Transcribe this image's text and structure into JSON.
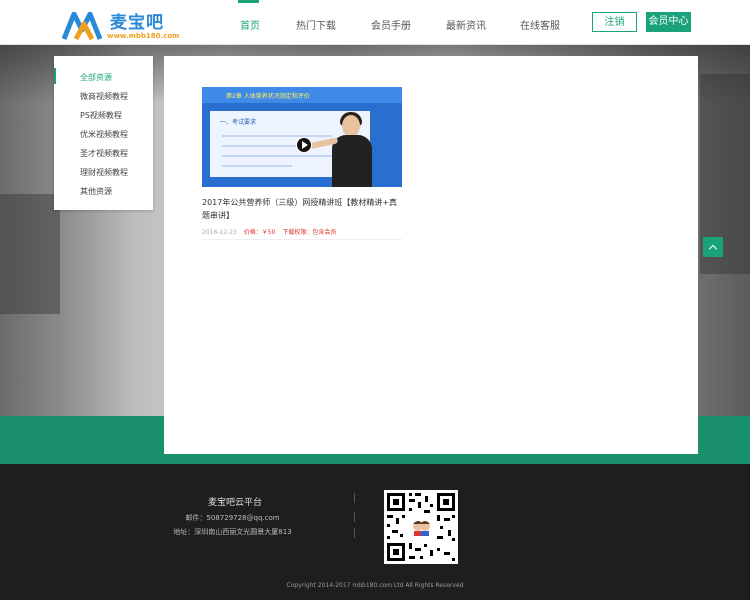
{
  "header": {
    "logo_text": "麦宝吧",
    "logo_url": "www.mbb180.com",
    "nav": [
      "首页",
      "热门下载",
      "会员手册",
      "最新资讯",
      "在线客服"
    ],
    "register_label": "注销",
    "member_label": "会员中心"
  },
  "sidebar": {
    "items": [
      "全部资源",
      "微商视频教程",
      "PS视频教程",
      "优米视频教程",
      "圣才视频教程",
      "理财视频教程",
      "其他资源"
    ]
  },
  "card": {
    "thumb_title": "第2章  人体营养状况测定和评价",
    "thumb_sub": "一、考试要求",
    "title": "2017年公共营养师（三级）网授精讲班【教材精讲+真题串讲】",
    "date": "2016-12-23",
    "price": "价格：￥50",
    "permission": "下载权限：包含会员"
  },
  "footer": {
    "title": "麦宝吧云平台",
    "email": "邮件：508729728@qq.com",
    "address": "地址：深圳南山西丽文光圆景大厦813",
    "copyright": "Copyright 2014-2017 mbb180.com Ltd All Rights Reserved"
  },
  "colors": {
    "accent": "#1aa37a",
    "footer_bg": "#1e1e1e",
    "band": "#1a8f6b",
    "price": "#e0312b"
  },
  "icons": {
    "to_top": "chevron-up-icon",
    "play": "play-icon"
  }
}
